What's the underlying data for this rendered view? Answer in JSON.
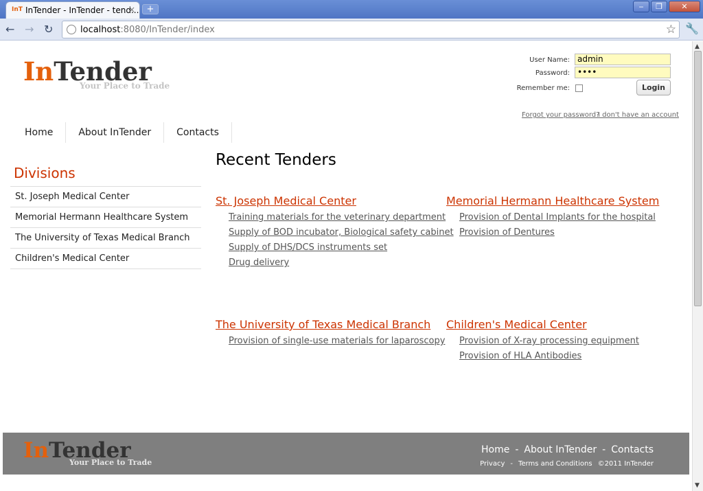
{
  "browser": {
    "tab_favicon": "InT",
    "tab_title": "InTender - InTender - tend...",
    "tab_close": "×",
    "new_tab": "+",
    "url_host": "localhost",
    "url_path": ":8080/InTender/index",
    "win_min": "‒",
    "win_max": "❐",
    "win_close": "✕",
    "back_icon": "←",
    "forward_icon": "→",
    "reload_icon": "↻",
    "star_icon": "☆",
    "wrench_icon": "🔧"
  },
  "header": {
    "logo_in": "In",
    "logo_tender": "Tender",
    "tagline": "Your Place to Trade"
  },
  "login": {
    "username_label": "User Name:",
    "username_value": "admin",
    "password_label": "Password:",
    "password_value": "••••",
    "remember_label": "Remember me:",
    "login_button": "Login",
    "forgot_link": "Forgot your password?",
    "no_account_link": "I don't have an account"
  },
  "nav": {
    "items": [
      {
        "label": "Home"
      },
      {
        "label": "About InTender"
      },
      {
        "label": "Contacts"
      }
    ]
  },
  "divisions": {
    "title": "Divisions",
    "items": [
      {
        "label": "St. Joseph Medical Center"
      },
      {
        "label": "Memorial Hermann Healthcare System"
      },
      {
        "label": "The University of Texas Medical Branch"
      },
      {
        "label": "Children's Medical Center"
      }
    ]
  },
  "recent": {
    "title": "Recent Tenders",
    "groups": [
      {
        "title": "St. Joseph Medical Center",
        "tenders": [
          "Training materials for the veterinary department",
          "Supply of BOD incubator, Biological safety cabinet",
          "Supply of DHS/DCS instruments set",
          "Drug delivery"
        ]
      },
      {
        "title": "Memorial Hermann Healthcare System",
        "tenders": [
          "Provision of Dental Implants for the hospital",
          "Provision of Dentures"
        ]
      },
      {
        "title": "The University of Texas Medical Branch",
        "tenders": [
          "Provision of single-use materials for laparoscopy"
        ]
      },
      {
        "title": "Children's Medical Center",
        "tenders": [
          "Provision of X-ray processing equipment",
          "Provision of HLA Antibodies"
        ]
      }
    ]
  },
  "footer": {
    "logo_in": "In",
    "logo_tender": "Tender",
    "tagline": "Your Place to Trade",
    "nav": [
      "Home",
      "About InTender",
      "Contacts"
    ],
    "separator": "-",
    "privacy": "Privacy",
    "terms": "Terms and Conditions",
    "copyright": "©2011 InTender"
  },
  "colors": {
    "accent": "#cc3300",
    "logo_orange": "#e4600c",
    "footer_bg": "#7f7f7f",
    "input_bg": "#fffbbf"
  }
}
